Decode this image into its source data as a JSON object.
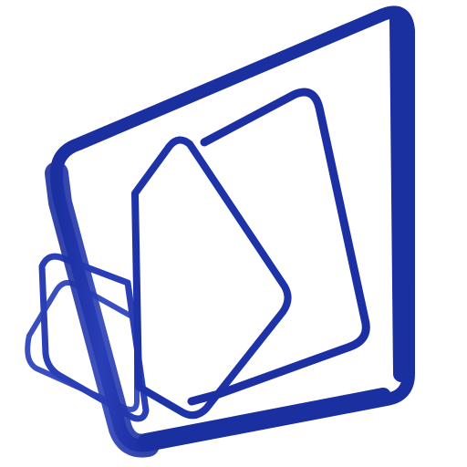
{
  "logo": {
    "icon": "stacked-cards-icon",
    "colors": {
      "primary": "#1a2fa0",
      "outline": "#2438b0",
      "light": "#4a5cc8",
      "background": "#ffffff"
    }
  }
}
